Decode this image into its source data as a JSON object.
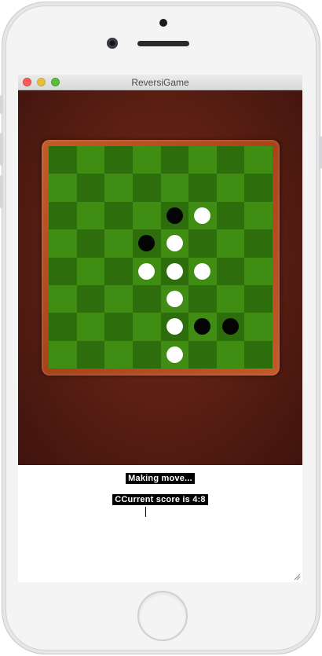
{
  "window": {
    "title": "ReversiGame"
  },
  "board": {
    "size": 8,
    "pieces": [
      {
        "row": 2,
        "col": 4,
        "color": "black"
      },
      {
        "row": 2,
        "col": 5,
        "color": "white"
      },
      {
        "row": 3,
        "col": 3,
        "color": "black"
      },
      {
        "row": 3,
        "col": 4,
        "color": "white"
      },
      {
        "row": 4,
        "col": 3,
        "color": "white"
      },
      {
        "row": 4,
        "col": 4,
        "color": "white"
      },
      {
        "row": 4,
        "col": 5,
        "color": "white"
      },
      {
        "row": 5,
        "col": 4,
        "color": "white"
      },
      {
        "row": 6,
        "col": 4,
        "color": "white"
      },
      {
        "row": 6,
        "col": 5,
        "color": "black"
      },
      {
        "row": 6,
        "col": 6,
        "color": "black"
      },
      {
        "row": 7,
        "col": 4,
        "color": "white"
      }
    ]
  },
  "status": {
    "message": "Making move...",
    "score_text": "CCurrent score is 4:8"
  },
  "colors": {
    "wood": "#5e2014",
    "frame": "#b84e22",
    "light_square": "#3f8e13",
    "dark_square": "#2d6d0c"
  }
}
